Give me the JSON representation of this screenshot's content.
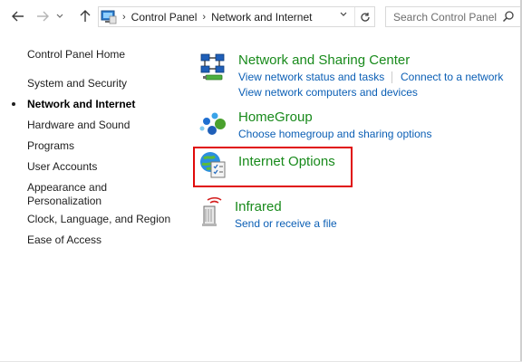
{
  "navigation": {
    "back_icon": "arrow-left-icon",
    "forward_icon": "arrow-right-icon",
    "history_icon": "chevron-down-icon",
    "up_icon": "arrow-up-icon"
  },
  "address_bar": {
    "icon": "control-panel-icon",
    "breadcrumbs": [
      "Control Panel",
      "Network and Internet"
    ],
    "refresh_icon": "refresh-icon"
  },
  "search": {
    "placeholder": "Search Control Panel",
    "icon": "search-icon"
  },
  "sidebar": {
    "home": "Control Panel Home",
    "items": [
      {
        "label": "System and Security",
        "current": false
      },
      {
        "label": "Network and Internet",
        "current": true
      },
      {
        "label": "Hardware and Sound",
        "current": false
      },
      {
        "label": "Programs",
        "current": false
      },
      {
        "label": "User Accounts",
        "current": false
      },
      {
        "label": "Appearance and Personalization",
        "current": false
      },
      {
        "label": "Clock, Language, and Region",
        "current": false
      },
      {
        "label": "Ease of Access",
        "current": false
      }
    ],
    "appearance_line1": "Appearance and",
    "appearance_line2": "Personalization"
  },
  "categories": [
    {
      "title": "Network and Sharing Center",
      "icon": "network-sharing-icon",
      "links": [
        "View network status and tasks",
        "Connect to a network",
        "View network computers and devices"
      ]
    },
    {
      "title": "HomeGroup",
      "icon": "homegroup-icon",
      "links": [
        "Choose homegroup and sharing options"
      ]
    },
    {
      "title": "Internet Options",
      "icon": "internet-options-icon",
      "links": [],
      "highlighted": true
    },
    {
      "title": "Infrared",
      "icon": "infrared-icon",
      "links": [
        "Send or receive a file"
      ]
    }
  ],
  "colors": {
    "category_title": "#188a1b",
    "link": "#0b5fb5",
    "highlight_border": "#e00a0a"
  }
}
